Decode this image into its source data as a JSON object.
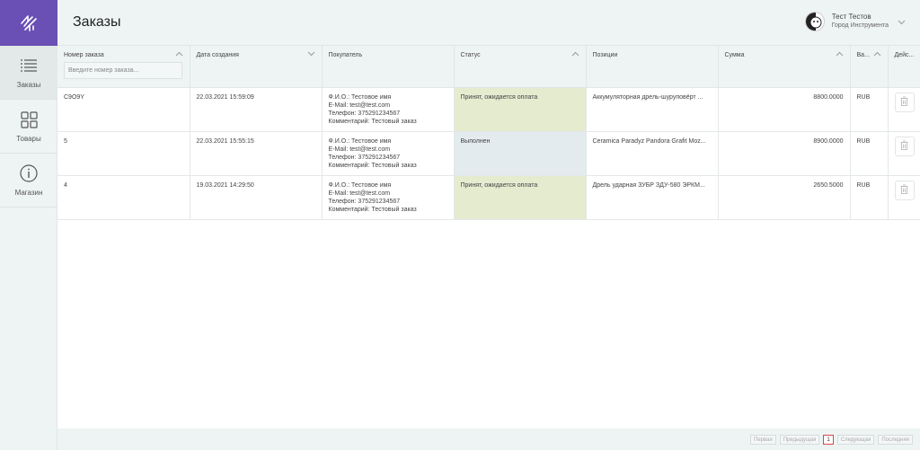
{
  "app": {
    "title": "Заказы"
  },
  "user": {
    "name": "Тест Тестов",
    "company": "Город Инструмента"
  },
  "sidebar": {
    "items": [
      {
        "label": "Заказы",
        "icon": "list-icon",
        "active": true
      },
      {
        "label": "Товары",
        "icon": "grid-icon",
        "active": false
      },
      {
        "label": "Магазин",
        "icon": "info-icon",
        "active": false
      }
    ]
  },
  "table": {
    "columns": [
      "Номер заказа",
      "Дата создания",
      "Покупатель",
      "Статус",
      "Позиции",
      "Сумма",
      "Ва...",
      "Дейс..."
    ],
    "filter": {
      "placeholder": "Введите номер заказа..."
    },
    "rows": [
      {
        "id": "C9O9Y",
        "date": "22.03.2021 15:59:09",
        "buyer": [
          "Ф.И.О.: Тестовое имя",
          "E-Mail: test@test.com",
          "Телефон: 375291234567",
          "Комментарий: Тестовый заказ"
        ],
        "status": "Принят, ожидается оплата",
        "positions": "Аккумуляторная дрель-шуруповёрт ...",
        "sum": "8800.0000",
        "currency": "RUB"
      },
      {
        "id": "5",
        "date": "22.03.2021 15:55:15",
        "buyer": [
          "Ф.И.О.: Тестовое имя",
          "E-Mail: test@test.com",
          "Телефон: 375291234567",
          "Комментарий: Тестовый заказ"
        ],
        "status": "Выполнен",
        "positions": "Ceramica Paradyz Pandora Grafit Moz...",
        "sum": "8900.0000",
        "currency": "RUB"
      },
      {
        "id": "4",
        "date": "19.03.2021 14:29:50",
        "buyer": [
          "Ф.И.О.: Тестовое имя",
          "E-Mail: test@test.com",
          "Телефон: 375291234567",
          "Комментарий: Тестовый заказ"
        ],
        "status": "Принят, ожидается оплата",
        "positions": "Дрель ударная ЗУБР ЗДУ-580 ЭРКМ...",
        "sum": "2650.5000",
        "currency": "RUB"
      }
    ]
  },
  "pagination": {
    "first": "Первая",
    "prev": "Предыдущая",
    "current": "1",
    "next": "Следующая",
    "last": "Последняя"
  },
  "colors": {
    "brand": "#6a4fb5",
    "pending": "#e4ebcf",
    "done": "#e4ebee"
  }
}
